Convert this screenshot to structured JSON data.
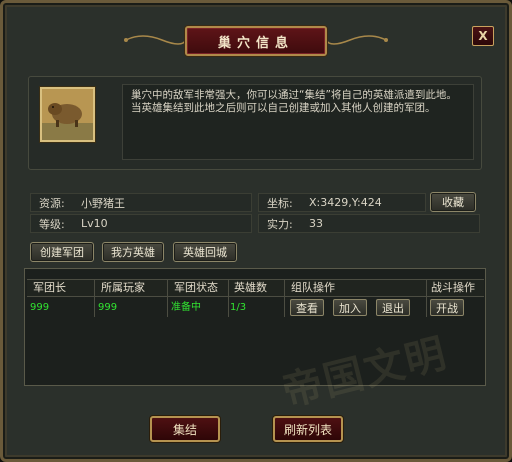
{
  "window": {
    "title": "巢穴信息",
    "close_label": "X"
  },
  "description": "巢穴中的敌军非常强大，你可以通过“集结”将自己的英雄派遣到此地。当英雄集结到此地之后则可以自己创建或加入其他人创建的军团。",
  "info": {
    "source_label": "资源:",
    "source_value": "小野猪王",
    "level_label": "等级:",
    "level_value": "Lv10",
    "coord_label": "坐标:",
    "coord_value": "X:3429,Y:424",
    "power_label": "实力:",
    "power_value": "33",
    "favorite_label": "收藏"
  },
  "actions": {
    "create_legion": "创建军团",
    "my_heroes": "我方英雄",
    "recall_heroes": "英雄回城"
  },
  "table": {
    "headers": [
      "军团长",
      "所属玩家",
      "军团状态",
      "英雄数",
      "组队操作",
      "战斗操作"
    ],
    "rows": [
      {
        "leader": "999",
        "player": "999",
        "status": "准备中",
        "heroes": "1/3",
        "view": "查看",
        "join": "加入",
        "leave": "退出",
        "battle": "开战"
      }
    ]
  },
  "footer": {
    "gather_label": "集结",
    "refresh_label": "刷新列表"
  },
  "watermark_text": "帝国文明"
}
